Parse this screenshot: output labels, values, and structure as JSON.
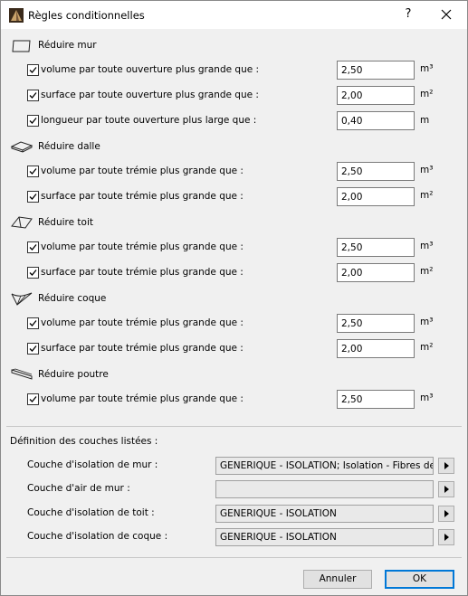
{
  "window": {
    "title": "Règles conditionnelles",
    "help": "?",
    "close": "✕"
  },
  "sections": [
    {
      "title": "Réduire mur",
      "icon": "wall-icon",
      "rows": [
        {
          "label": "volume par toute ouverture plus grande que :",
          "value": "2,50",
          "unit": "m³",
          "checked": true
        },
        {
          "label": "surface par toute ouverture plus grande que :",
          "value": "2,00",
          "unit": "m²",
          "checked": true
        },
        {
          "label": "longueur par toute ouverture plus large que :",
          "value": "0,40",
          "unit": "m",
          "checked": true
        }
      ]
    },
    {
      "title": "Réduire dalle",
      "icon": "slab-icon",
      "rows": [
        {
          "label": "volume par toute trémie plus grande que :",
          "value": "2,50",
          "unit": "m³",
          "checked": true
        },
        {
          "label": "surface par toute trémie plus grande que :",
          "value": "2,00",
          "unit": "m²",
          "checked": true
        }
      ]
    },
    {
      "title": "Réduire toit",
      "icon": "roof-icon",
      "rows": [
        {
          "label": "volume par toute trémie plus grande que :",
          "value": "2,50",
          "unit": "m³",
          "checked": true
        },
        {
          "label": "surface par toute trémie plus grande que :",
          "value": "2,00",
          "unit": "m²",
          "checked": true
        }
      ]
    },
    {
      "title": "Réduire coque",
      "icon": "shell-icon",
      "rows": [
        {
          "label": "volume par toute trémie plus grande que :",
          "value": "2,50",
          "unit": "m³",
          "checked": true
        },
        {
          "label": "surface par toute trémie plus grande que :",
          "value": "2,00",
          "unit": "m²",
          "checked": true
        }
      ]
    },
    {
      "title": "Réduire poutre",
      "icon": "beam-icon",
      "rows": [
        {
          "label": "volume par toute trémie plus grande que :",
          "value": "2,50",
          "unit": "m³",
          "checked": true
        }
      ]
    }
  ],
  "layers": {
    "heading": "Définition des couches listées :",
    "items": [
      {
        "label": "Couche d'isolation de mur :",
        "value": "GENERIQUE - ISOLATION; Isolation - Fibres de"
      },
      {
        "label": "Couche d'air de mur :",
        "value": ""
      },
      {
        "label": "Couche d'isolation de toit :",
        "value": "GENERIQUE - ISOLATION"
      },
      {
        "label": "Couche d'isolation de coque :",
        "value": "GENERIQUE - ISOLATION"
      }
    ]
  },
  "buttons": {
    "cancel": "Annuler",
    "ok": "OK"
  },
  "colors": {
    "accent": "#0078d7",
    "background": "#f0f0f0"
  }
}
